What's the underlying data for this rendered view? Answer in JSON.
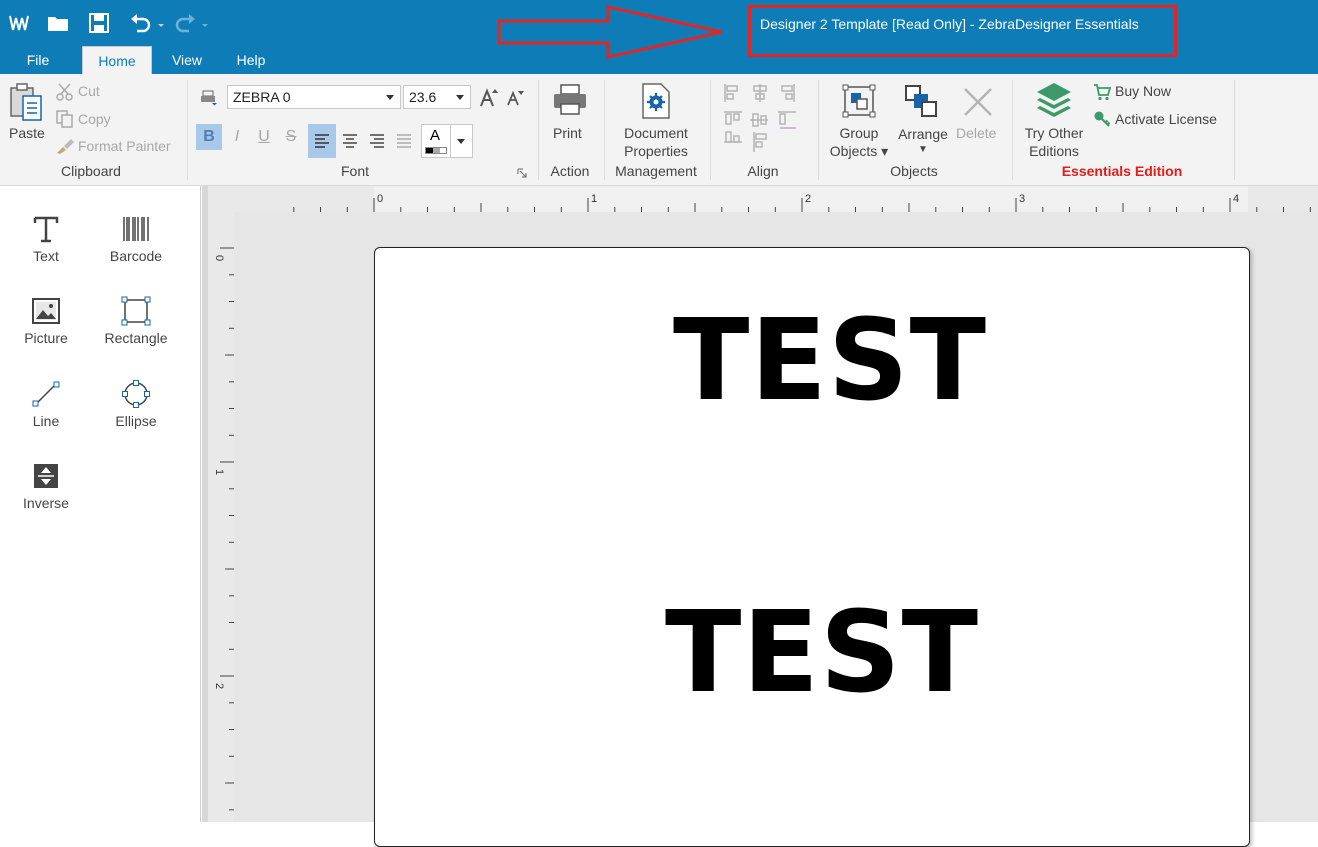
{
  "window": {
    "title": "Designer 2 Template [Read Only] - ZebraDesigner Essentials"
  },
  "colors": {
    "accent": "#0e7db7",
    "annotation": "#e22525",
    "essentials": "#e21b1b"
  },
  "quick_access": {
    "icons": [
      "app-logo-icon",
      "open-icon",
      "save-icon",
      "undo-icon",
      "redo-icon"
    ]
  },
  "tabs": [
    {
      "label": "File"
    },
    {
      "label": "Home"
    },
    {
      "label": "View"
    },
    {
      "label": "Help"
    }
  ],
  "ribbon": {
    "clipboard": {
      "paste": "Paste",
      "cut": "Cut",
      "copy": "Copy",
      "format_painter": "Format Painter",
      "group": "Clipboard"
    },
    "font": {
      "name": "ZEBRA 0",
      "size": "23.6",
      "color_letter": "A",
      "group": "Font"
    },
    "action": {
      "print": "Print",
      "group": "Action"
    },
    "management": {
      "doc_line1": "Document",
      "doc_line2": "Properties",
      "group": "Management"
    },
    "align": {
      "group": "Align"
    },
    "objects": {
      "group_line1": "Group",
      "group_line2": "Objects",
      "arrange": "Arrange",
      "delete": "Delete",
      "group": "Objects"
    },
    "edition": {
      "try_line1": "Try Other",
      "try_line2": "Editions",
      "buy_now": "Buy Now",
      "activate": "Activate License",
      "group": "Essentials Edition"
    }
  },
  "toolbox": [
    {
      "label": "Text"
    },
    {
      "label": "Barcode"
    },
    {
      "label": "Picture"
    },
    {
      "label": "Rectangle"
    },
    {
      "label": "Line"
    },
    {
      "label": "Ellipse"
    },
    {
      "label": "Inverse"
    }
  ],
  "rulers": {
    "horizontal": [
      "0",
      "1",
      "2",
      "3",
      "4"
    ],
    "vertical": [
      "0",
      "1",
      "2"
    ]
  },
  "label": {
    "objects": [
      {
        "text": "TEST"
      },
      {
        "text": "TEST"
      }
    ]
  }
}
